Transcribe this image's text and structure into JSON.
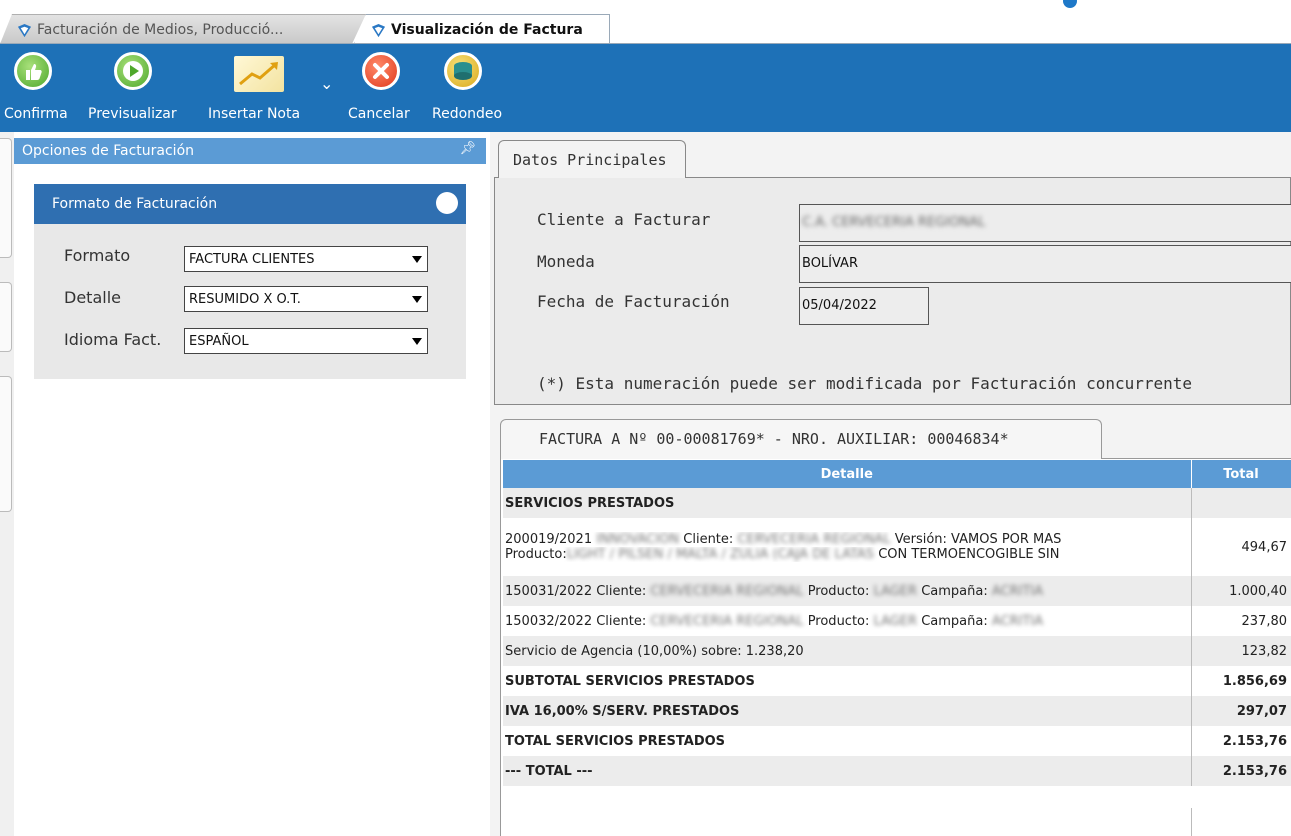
{
  "tabs": [
    {
      "label": "Facturación de Medios, Producció..."
    },
    {
      "label": "Visualización de Factura"
    }
  ],
  "toolbar": {
    "confirma": "Confirma",
    "previsualizar": "Previsualizar",
    "insertar_nota": "Insertar Nota",
    "cancelar": "Cancelar",
    "redondeo": "Redondeo"
  },
  "options": {
    "title": "Opciones de Facturación",
    "card_title": "Formato de Facturación",
    "formato_label": "Formato",
    "formato_value": "FACTURA CLIENTES",
    "detalle_label": "Detalle",
    "detalle_value": "RESUMIDO X O.T.",
    "idioma_label": "Idioma Fact.",
    "idioma_value": "ESPAÑOL"
  },
  "datos": {
    "tab": "Datos Principales",
    "cliente_label": "Cliente a Facturar",
    "cliente_value": "C.A. CERVECERIA REGIONAL",
    "moneda_label": "Moneda",
    "moneda_value": "BOLÍVAR",
    "fecha_label": "Fecha de Facturación",
    "fecha_value": "05/04/2022",
    "note": "(*) Esta numeración puede ser modificada por Facturación concurrente"
  },
  "factura": {
    "tab": "FACTURA A Nº 00-00081769* - NRO. AUXILIAR: 00046834*",
    "col_detalle": "Detalle",
    "col_total": "Total",
    "section": "SERVICIOS PRESTADOS",
    "r1_a": "200019/2021",
    "r1_b": "INNOVACION",
    "r1_c": "Cliente:",
    "r1_d": "CERVECERIA REGIONAL",
    "r1_e": "Versión: VAMOS POR MAS",
    "r1_f": "Producto:",
    "r1_g": "LIGHT / PILSEN / MALTA / ZULIA  (CAJA DE LATAS",
    "r1_h": "CON TERMOENCOGIBLE SIN",
    "r1_total": "494,67",
    "r2_a": "150031/2022 Cliente:",
    "r2_b": "CERVECERIA REGIONAL",
    "r2_c": "Producto:",
    "r2_d": "LAGER",
    "r2_e": "Campaña:",
    "r2_f": "ACRITIA",
    "r2_total": "1.000,40",
    "r3_a": "150032/2022 Cliente:",
    "r3_b": "CERVECERIA REGIONAL",
    "r3_c": "Producto:",
    "r3_d": "LAGER",
    "r3_e": "Campaña:",
    "r3_f": "ACRITIA",
    "r3_total": "237,80",
    "agencia": "Servicio de Agencia (10,00%) sobre: 1.238,20",
    "agencia_total": "123,82",
    "subtotal": "SUBTOTAL SERVICIOS PRESTADOS",
    "subtotal_total": "1.856,69",
    "iva": "IVA 16,00% S/SERV. PRESTADOS",
    "iva_total": "297,07",
    "total_serv": "TOTAL SERVICIOS PRESTADOS",
    "total_serv_total": "2.153,76",
    "grand": "--- TOTAL ---",
    "grand_total": "2.153,76"
  },
  "colors": {
    "toolbar": "#1e71b7",
    "header": "#5b9bd5",
    "card_header": "#2f6fb1"
  }
}
